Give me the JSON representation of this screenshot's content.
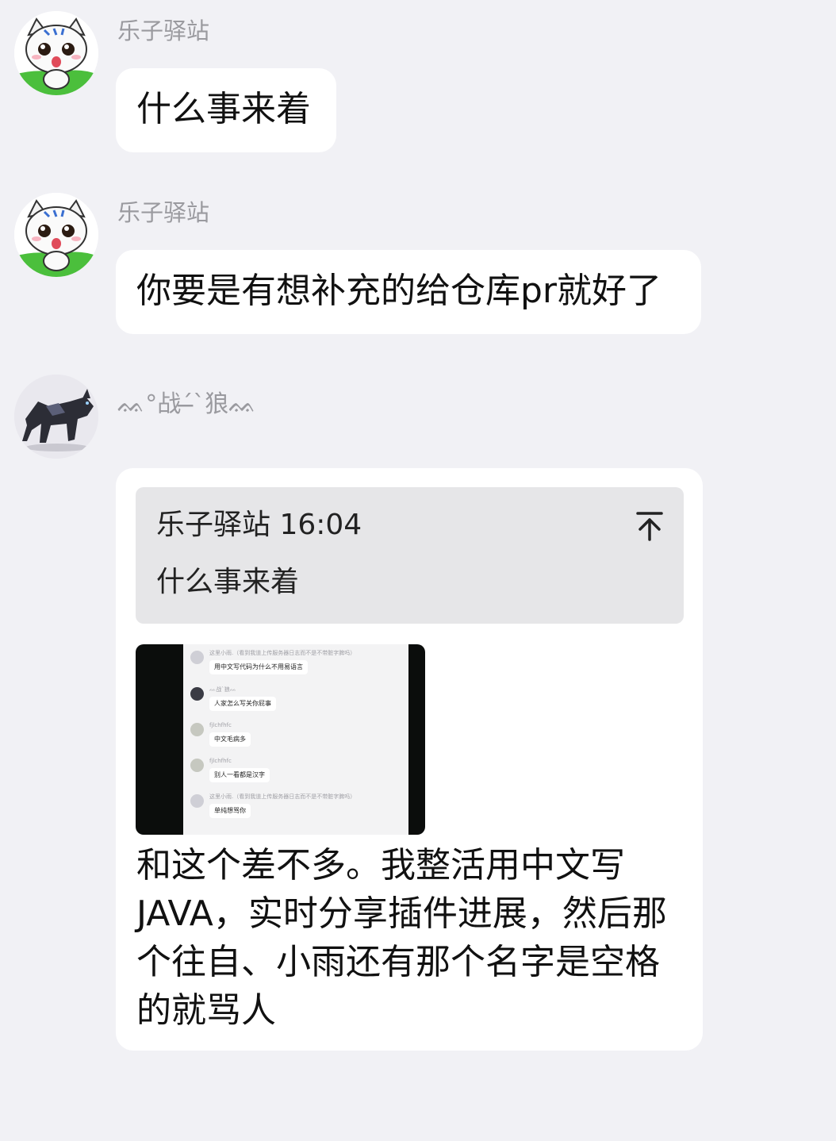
{
  "messages": [
    {
      "sender": "乐子驿站",
      "avatar": "cat-avatar-icon",
      "text": "什么事来着"
    },
    {
      "sender": "乐子驿站",
      "avatar": "cat-avatar-icon",
      "text": "你要是有想补充的给仓库pr就好了"
    },
    {
      "sender": "ᨐ°战ˊ̶̶̶ˋ狼ᨐ",
      "avatar": "wolf-avatar-icon",
      "quote": {
        "header": "乐子驿站 16:04",
        "text": "什么事来着",
        "icon": "jump-to-top-icon"
      },
      "image": {
        "items": [
          {
            "name": "这里小雨.（看到我道上传服务器日志而不是不带脏字脾吗）",
            "text": "用中文写代码为什么不用易语言"
          },
          {
            "name": "ᨐ战ˋ狼ᨐ",
            "text": "人家怎么写关你屁事"
          },
          {
            "name": "fjlchfhfc",
            "text": "中文毛病多"
          },
          {
            "name": "fjlchfhfc",
            "text": "别人一看都是汉字"
          },
          {
            "name": "这里小雨.（看到我道上传服务器日志而不是不带脏字脾吗）",
            "text": "单纯想骂你"
          }
        ]
      },
      "text_lines": [
        "和这个差不多。我整活用中文写",
        "JAVA，实时分享插件进展，然后那",
        "个往自、小雨还有那个名字是空格",
        "的就骂人"
      ]
    }
  ]
}
